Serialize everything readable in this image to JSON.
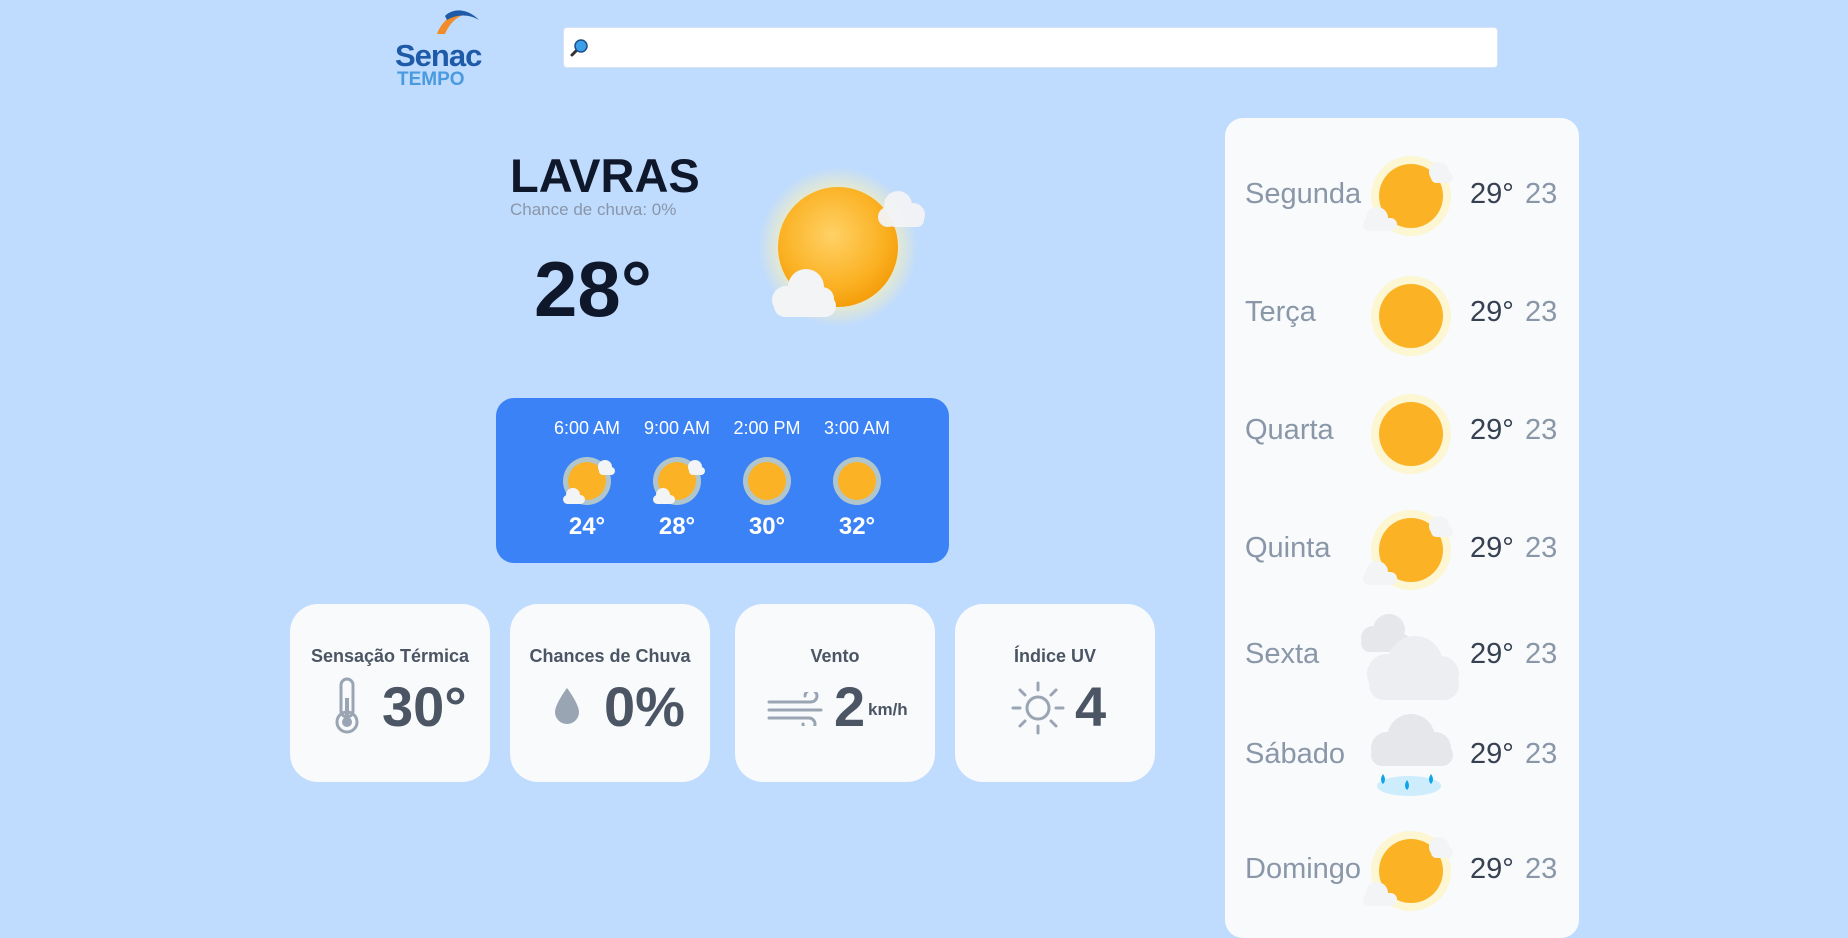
{
  "header": {
    "logo_brand": "Senac",
    "logo_sub": "TEMPO",
    "search_value": "",
    "search_placeholder": ""
  },
  "current": {
    "city": "LAVRAS",
    "rain_chance": "Chance de chuva: 0%",
    "temperature": "28°",
    "icon": "sun-cloud-icon"
  },
  "hourly": [
    {
      "time": "6:00 AM",
      "temp": "24°",
      "icon": "sun-cloud-icon"
    },
    {
      "time": "9:00 AM",
      "temp": "28°",
      "icon": "sun-cloud-icon"
    },
    {
      "time": "2:00 PM",
      "temp": "30°",
      "icon": "sun-icon"
    },
    {
      "time": "3:00 AM",
      "temp": "32°",
      "icon": "sun-icon"
    }
  ],
  "cards": {
    "feels_like": {
      "title": "Sensação Térmica",
      "value": "30°",
      "icon": "thermometer-icon"
    },
    "rain": {
      "title": "Chances de Chuva",
      "value": "0%",
      "icon": "raindrop-icon"
    },
    "wind": {
      "title": "Vento",
      "value": "2",
      "unit": "km/h",
      "icon": "wind-icon"
    },
    "uv": {
      "title": "Índice UV",
      "value": "4",
      "icon": "uv-sun-icon"
    }
  },
  "week": [
    {
      "day": "Segunda",
      "max": "29°",
      "min": "23",
      "icon": "sun-cloud-icon"
    },
    {
      "day": "Terça",
      "max": "29°",
      "min": "23",
      "icon": "sun-icon"
    },
    {
      "day": "Quarta",
      "max": "29°",
      "min": "23",
      "icon": "sun-icon"
    },
    {
      "day": "Quinta",
      "max": "29°",
      "min": "23",
      "icon": "sun-cloud-icon"
    },
    {
      "day": "Sexta",
      "max": "29°",
      "min": "23",
      "icon": "cloudy-icon"
    },
    {
      "day": "Sábado",
      "max": "29°",
      "min": "23",
      "icon": "rain-icon"
    },
    {
      "day": "Domingo",
      "max": "29°",
      "min": "23",
      "icon": "sun-cloud-icon"
    }
  ],
  "colors": {
    "background": "#bfdbfe",
    "panel": "#f8fafc",
    "hourly_panel": "#3b82f6",
    "sun": "#f59e0b",
    "text_dark": "#0f172a",
    "text_muted": "#8a97a8"
  }
}
